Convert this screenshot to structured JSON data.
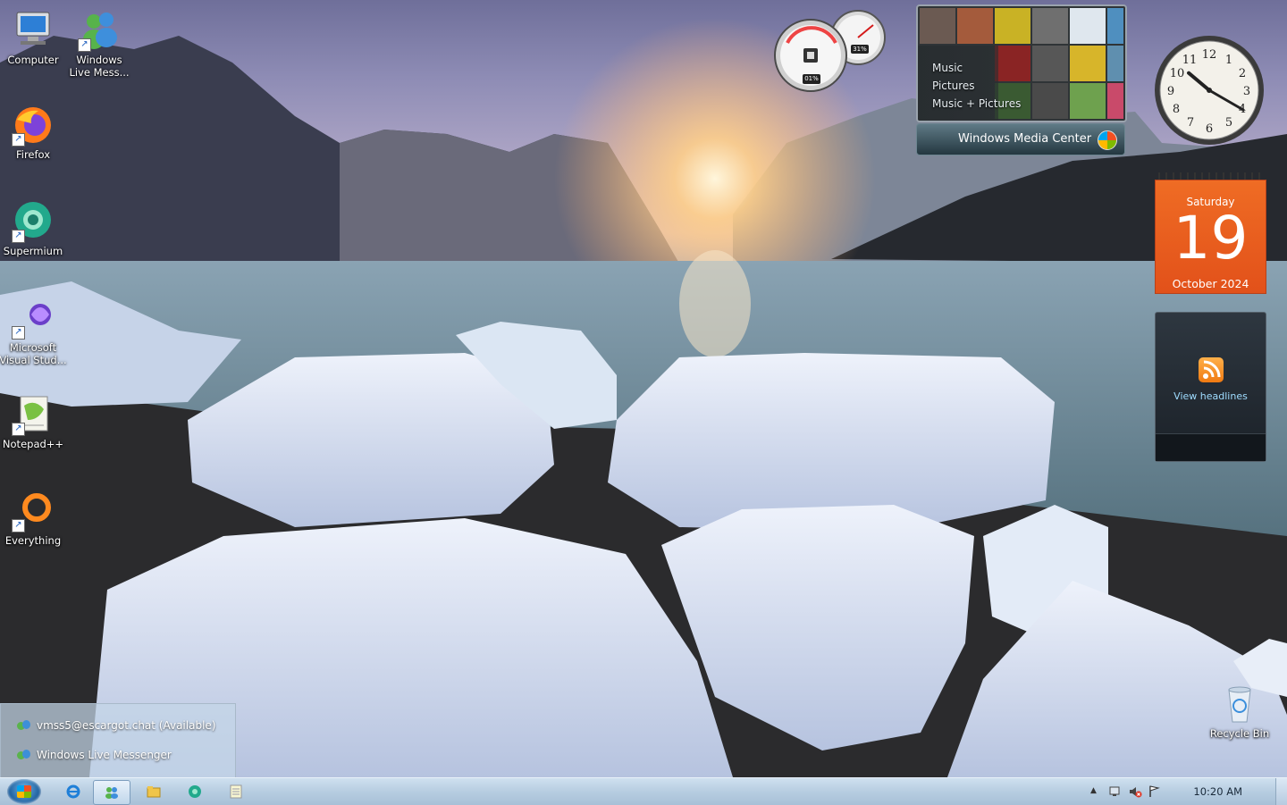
{
  "desktop_icons": [
    {
      "label": "Computer",
      "icon": "computer-icon"
    },
    {
      "label": "Windows\nLive Mess...",
      "icon": "windows-live-messenger-icon"
    },
    {
      "label": "Firefox",
      "icon": "firefox-icon"
    },
    {
      "label": "Supermium",
      "icon": "supermium-icon"
    },
    {
      "label": "Microsoft\nVisual Stud...",
      "icon": "visual-studio-icon"
    },
    {
      "label": "Notepad++",
      "icon": "notepadpp-icon"
    },
    {
      "label": "Everything",
      "icon": "everything-icon"
    },
    {
      "label": "Recycle Bin",
      "icon": "recycle-bin-icon"
    }
  ],
  "cpu_meter": {
    "cpu": "01%",
    "memory": "31%"
  },
  "media_center": {
    "items": [
      "Music",
      "Pictures",
      "Music + Pictures"
    ],
    "title": "Windows Media Center"
  },
  "clock": {
    "hour": 10,
    "minute": 20
  },
  "calendar": {
    "day_of_week": "Saturday",
    "day": "19",
    "month_year": "October 2024"
  },
  "feed_headlines": {
    "label": "View headlines"
  },
  "messenger_popup": {
    "items": [
      {
        "text": "vmss5@escargot.chat (Available)"
      },
      {
        "text": "Windows Live Messenger"
      }
    ]
  },
  "taskbar": {
    "pinned": [
      "internet-explorer-icon",
      "windows-live-messenger-icon",
      "explorer-icon",
      "supermium-icon",
      "notepad-icon"
    ],
    "active_index": 1,
    "time": "10:20 AM"
  }
}
